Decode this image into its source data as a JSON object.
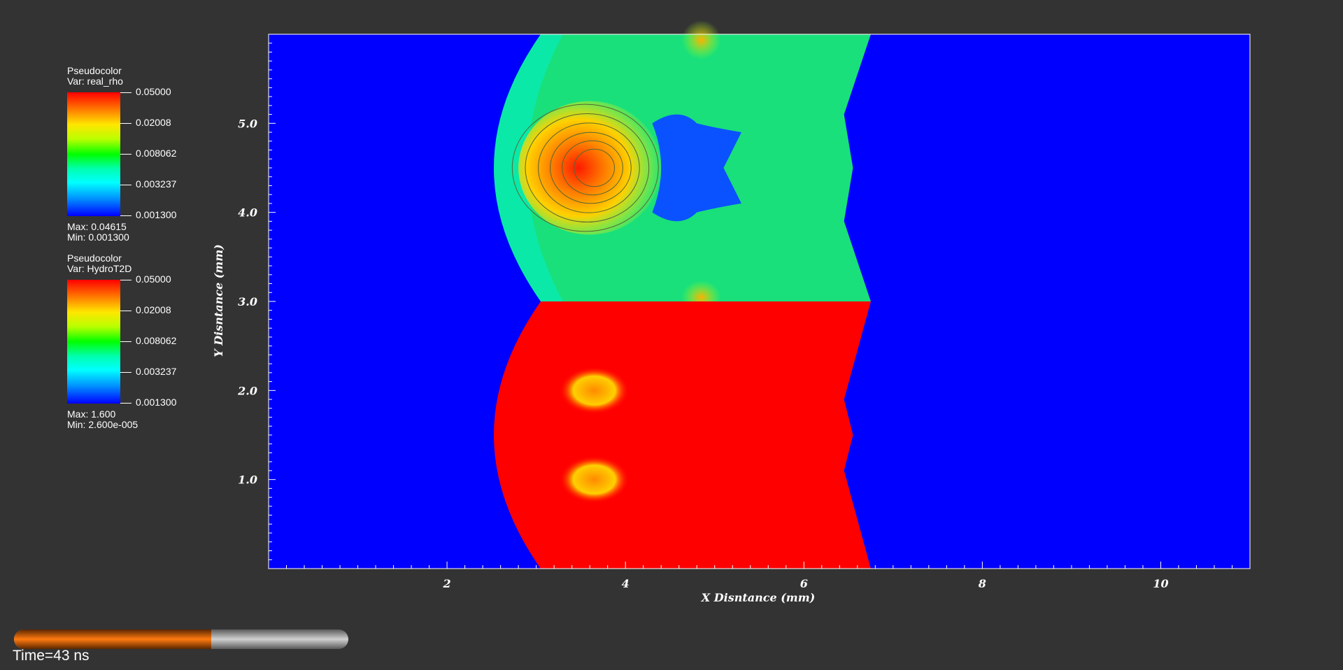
{
  "legend1": {
    "title": "Pseudocolor",
    "var": "Var: real_rho",
    "ticks": [
      "0.05000",
      "0.02008",
      "0.008062",
      "0.003237",
      "0.001300"
    ],
    "max": "Max:  0.04615",
    "min": "Min:  0.001300"
  },
  "legend2": {
    "title": "Pseudocolor",
    "var": "Var: HydroT2D",
    "ticks": [
      "0.05000",
      "0.02008",
      "0.008062",
      "0.003237",
      "0.001300"
    ],
    "max": "Max:  1.600",
    "min": "Min:  2.600e-005"
  },
  "chart_data": {
    "type": "heatmap",
    "xlabel": "X Disntance (mm)",
    "ylabel": "Y Disntance (mm)",
    "xlim": [
      0,
      11
    ],
    "ylim": [
      0,
      6
    ],
    "xticks": [
      {
        "value": 2,
        "label": "2"
      },
      {
        "value": 4,
        "label": "4"
      },
      {
        "value": 6,
        "label": "6"
      },
      {
        "value": 8,
        "label": "8"
      },
      {
        "value": 10,
        "label": "10"
      }
    ],
    "yticks": [
      {
        "value": 1,
        "label": "1.0"
      },
      {
        "value": 2,
        "label": "2.0"
      },
      {
        "value": 3,
        "label": "3.0"
      },
      {
        "value": 4,
        "label": "4.0"
      },
      {
        "value": 5,
        "label": "5.0"
      }
    ],
    "background_color": "#0000ff",
    "upper_half_color": "#19e07a",
    "lower_half_color": "#ff0000"
  },
  "progress": {
    "fraction": 0.59
  },
  "time_text": "Time=43 ns"
}
